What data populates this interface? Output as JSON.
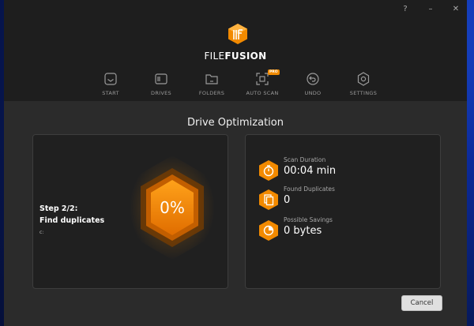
{
  "window_controls": {
    "help": "?",
    "minimize": "–",
    "close": "✕"
  },
  "brand": {
    "part1": "FILE",
    "part2": "FUSION",
    "accent": "#f28a00"
  },
  "nav": {
    "items": [
      {
        "label": "START",
        "icon": "start-icon"
      },
      {
        "label": "DRIVES",
        "icon": "drives-icon"
      },
      {
        "label": "FOLDERS",
        "icon": "folder-icon"
      },
      {
        "label": "AUTO SCAN",
        "icon": "auto-scan-icon",
        "badge": "PRO"
      },
      {
        "label": "UNDO",
        "icon": "undo-icon"
      },
      {
        "label": "SETTINGS",
        "icon": "gear-icon"
      }
    ]
  },
  "page": {
    "title": "Drive Optimization"
  },
  "progress": {
    "step_line1": "Step 2/2:",
    "step_line2": "Find duplicates",
    "drive": "c:",
    "percent": "0%"
  },
  "stats": {
    "scan_duration": {
      "label": "Scan Duration",
      "value": "00:04 min",
      "icon": "stopwatch-icon"
    },
    "found_duplicates": {
      "label": "Found Duplicates",
      "value": "0",
      "icon": "duplicates-icon"
    },
    "possible_savings": {
      "label": "Possible Savings",
      "value": "0 bytes",
      "icon": "savings-icon"
    }
  },
  "actions": {
    "cancel": "Cancel"
  }
}
